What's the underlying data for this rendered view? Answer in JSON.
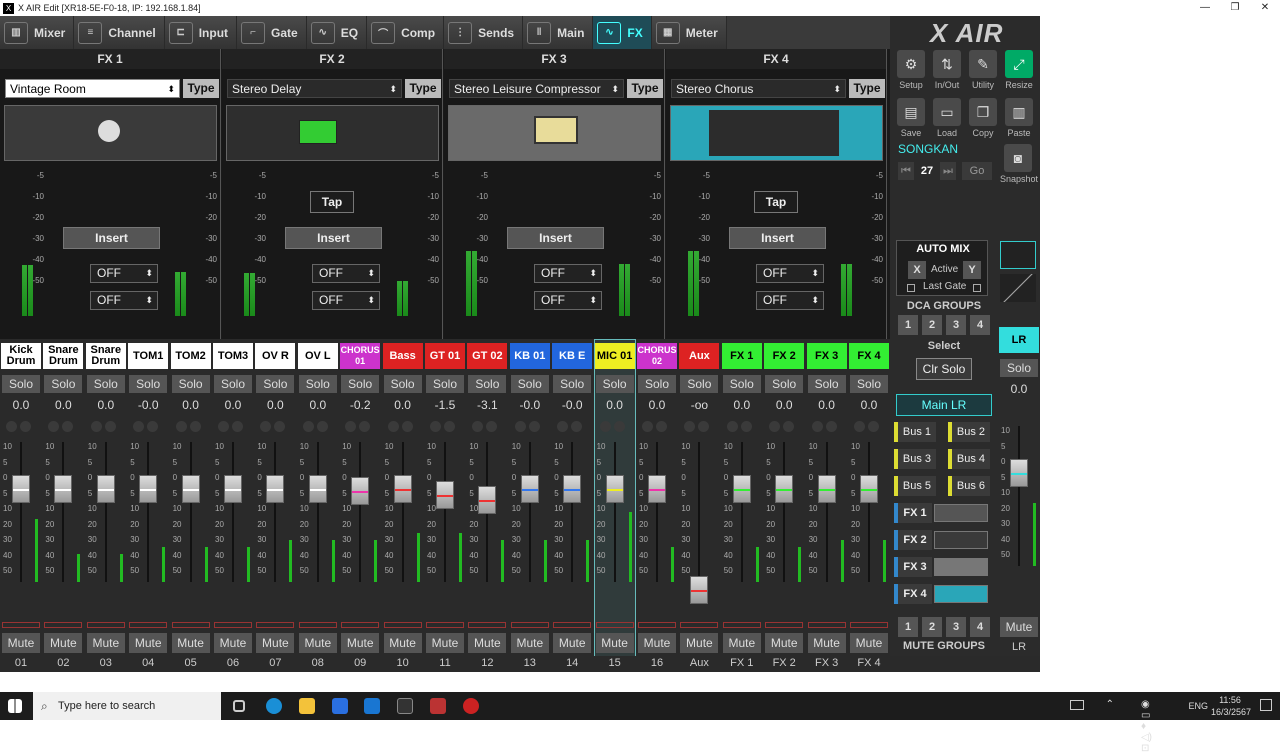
{
  "window": {
    "title": "X AIR Edit [XR18-5E-F0-18, IP: 192.168.1.84]",
    "app_icon": "X",
    "controls": [
      "—",
      "❐",
      "✕"
    ]
  },
  "tabs": [
    {
      "label": "Mixer",
      "icon": "mixer-icon",
      "glyph": "▥"
    },
    {
      "label": "Channel",
      "icon": "channel-icon",
      "glyph": "≡"
    },
    {
      "label": "Input",
      "icon": "input-icon",
      "glyph": "⊏"
    },
    {
      "label": "Gate",
      "icon": "gate-icon",
      "glyph": "⌐"
    },
    {
      "label": "EQ",
      "icon": "eq-icon",
      "glyph": "∿"
    },
    {
      "label": "Comp",
      "icon": "comp-icon",
      "glyph": "⌒"
    },
    {
      "label": "Sends",
      "icon": "sends-icon",
      "glyph": "⋮"
    },
    {
      "label": "Main",
      "icon": "main-icon",
      "glyph": "‖"
    },
    {
      "label": "FX",
      "icon": "fx-icon",
      "glyph": "∿",
      "active": true
    },
    {
      "label": "Meter",
      "icon": "meter-icon",
      "glyph": "▦"
    }
  ],
  "fx_units": [
    {
      "header": "FX 1",
      "preset": "Vintage Room",
      "type_label": "Type",
      "insert_label": "Insert",
      "off1": "OFF",
      "off2": "OFF",
      "theme": "light"
    },
    {
      "header": "FX 2",
      "preset": "Stereo Delay",
      "type_label": "Type",
      "insert_label": "Insert",
      "tap_label": "Tap",
      "off1": "OFF",
      "off2": "OFF",
      "theme": "dark"
    },
    {
      "header": "FX 3",
      "preset": "Stereo Leisure Compressor",
      "type_label": "Type",
      "insert_label": "Insert",
      "off1": "OFF",
      "off2": "OFF",
      "theme": "dark"
    },
    {
      "header": "FX 4",
      "preset": "Stereo Chorus",
      "type_label": "Type",
      "insert_label": "Insert",
      "tap_label": "Tap",
      "off1": "OFF",
      "off2": "OFF",
      "theme": "dark"
    }
  ],
  "fx_meter_scale": [
    "-5",
    "-10",
    "-20",
    "-30",
    "-40",
    "-50"
  ],
  "fader_scale": [
    "10",
    "5",
    "0",
    "5",
    "10",
    "20",
    "30",
    "40",
    "50"
  ],
  "channels": [
    {
      "name": "Kick Drum",
      "color": "#ffffff",
      "solo": "Solo",
      "gain": "0.0",
      "mute": "Mute",
      "num": "01",
      "fader": 0.72,
      "level": 0.45,
      "stripe": "#fff"
    },
    {
      "name": "Snare Drum",
      "color": "#ffffff",
      "solo": "Solo",
      "gain": "0.0",
      "mute": "Mute",
      "num": "02",
      "fader": 0.72,
      "level": 0.2,
      "stripe": "#fff"
    },
    {
      "name": "Snare Drum",
      "color": "#ffffff",
      "solo": "Solo",
      "gain": "0.0",
      "mute": "Mute",
      "num": "03",
      "fader": 0.72,
      "level": 0.2,
      "stripe": "#fff"
    },
    {
      "name": "TOM1",
      "color": "#ffffff",
      "solo": "Solo",
      "gain": "-0.0",
      "mute": "Mute",
      "num": "04",
      "fader": 0.72,
      "level": 0.25,
      "stripe": "#fff"
    },
    {
      "name": "TOM2",
      "color": "#ffffff",
      "solo": "Solo",
      "gain": "0.0",
      "mute": "Mute",
      "num": "05",
      "fader": 0.72,
      "level": 0.25,
      "stripe": "#fff"
    },
    {
      "name": "TOM3",
      "color": "#ffffff",
      "solo": "Solo",
      "gain": "0.0",
      "mute": "Mute",
      "num": "06",
      "fader": 0.72,
      "level": 0.25,
      "stripe": "#fff"
    },
    {
      "name": "OV R",
      "color": "#ffffff",
      "solo": "Solo",
      "gain": "0.0",
      "mute": "Mute",
      "num": "07",
      "fader": 0.72,
      "level": 0.3,
      "stripe": "#fff"
    },
    {
      "name": "OV L",
      "color": "#ffffff",
      "solo": "Solo",
      "gain": "0.0",
      "mute": "Mute",
      "num": "08",
      "fader": 0.72,
      "level": 0.3,
      "stripe": "#fff"
    },
    {
      "name": "CHORUS 01",
      "color": "#cc33cc",
      "solo": "Solo",
      "gain": "-0.2",
      "mute": "Mute",
      "num": "09",
      "fader": 0.71,
      "level": 0.3,
      "stripe": "#e3a"
    },
    {
      "name": "Bass",
      "color": "#dd2222",
      "solo": "Solo",
      "gain": "0.0",
      "mute": "Mute",
      "num": "10",
      "fader": 0.72,
      "level": 0.35,
      "stripe": "#e33"
    },
    {
      "name": "GT 01",
      "color": "#dd2222",
      "solo": "Solo",
      "gain": "-1.5",
      "mute": "Mute",
      "num": "11",
      "fader": 0.68,
      "level": 0.35,
      "stripe": "#e33"
    },
    {
      "name": "GT 02",
      "color": "#dd2222",
      "solo": "Solo",
      "gain": "-3.1",
      "mute": "Mute",
      "num": "12",
      "fader": 0.64,
      "level": 0.3,
      "stripe": "#e33"
    },
    {
      "name": "KB 01",
      "color": "#2266dd",
      "solo": "Solo",
      "gain": "-0.0",
      "mute": "Mute",
      "num": "13",
      "fader": 0.72,
      "level": 0.3,
      "stripe": "#37e"
    },
    {
      "name": "KB E",
      "color": "#2266dd",
      "solo": "Solo",
      "gain": "-0.0",
      "mute": "Mute",
      "num": "14",
      "fader": 0.72,
      "level": 0.3,
      "stripe": "#37e"
    },
    {
      "name": "MIC 01",
      "color": "#eeee22",
      "solo": "Solo",
      "gain": "0.0",
      "mute": "Mute",
      "num": "15",
      "fader": 0.72,
      "level": 0.5,
      "stripe": "#ee2",
      "selected": true
    },
    {
      "name": "CHORUS 02",
      "color": "#cc33cc",
      "solo": "Solo",
      "gain": "0.0",
      "mute": "Mute",
      "num": "16",
      "fader": 0.72,
      "level": 0.25,
      "stripe": "#e3a"
    },
    {
      "name": "Aux",
      "color": "#dd2222",
      "solo": "Solo",
      "gain": "-oo",
      "mute": "Mute",
      "num": "Aux",
      "fader": 0.0,
      "level": 0.0,
      "stripe": "#e33"
    },
    {
      "name": "FX 1",
      "color": "#33ee33",
      "solo": "Solo",
      "gain": "0.0",
      "mute": "Mute",
      "num": "FX 1",
      "fader": 0.72,
      "level": 0.25,
      "stripe": "#3e3"
    },
    {
      "name": "FX 2",
      "color": "#33ee33",
      "solo": "Solo",
      "gain": "0.0",
      "mute": "Mute",
      "num": "FX 2",
      "fader": 0.72,
      "level": 0.25,
      "stripe": "#3e3"
    },
    {
      "name": "FX 3",
      "color": "#33ee33",
      "solo": "Solo",
      "gain": "0.0",
      "mute": "Mute",
      "num": "FX 3",
      "fader": 0.72,
      "level": 0.3,
      "stripe": "#3e3"
    },
    {
      "name": "FX 4",
      "color": "#33ee33",
      "solo": "Solo",
      "gain": "0.0",
      "mute": "Mute",
      "num": "FX 4",
      "fader": 0.72,
      "level": 0.3,
      "stripe": "#3e3"
    }
  ],
  "lr": {
    "name": "LR",
    "color": "#33dddd",
    "solo": "Solo",
    "gain": "0.0",
    "mute": "Mute",
    "num": "LR",
    "level": 0.45
  },
  "right_panel": {
    "logo": "X AIR",
    "top_buttons": [
      {
        "label": "Setup",
        "glyph": "⚙",
        "icon": "setup-icon"
      },
      {
        "label": "In/Out",
        "glyph": "⇅",
        "icon": "in-out-icon"
      },
      {
        "label": "Utility",
        "glyph": "✎",
        "icon": "utility-icon"
      },
      {
        "label": "Resize",
        "glyph": "⤢",
        "icon": "resize-icon",
        "active": true
      }
    ],
    "file_buttons": [
      {
        "label": "Save",
        "glyph": "▤",
        "icon": "save-icon"
      },
      {
        "label": "Load",
        "glyph": "▭",
        "icon": "load-icon"
      },
      {
        "label": "Copy",
        "glyph": "❐",
        "icon": "copy-icon"
      },
      {
        "label": "Paste",
        "glyph": "▥",
        "icon": "paste-icon"
      }
    ],
    "song": "SONGKAN",
    "snap_number": "27",
    "go_label": "Go",
    "snapshot_label": "Snapshot",
    "automix": {
      "title": "AUTO MIX",
      "x": "X",
      "active": "Active",
      "y": "Y",
      "last_gate": "Last Gate"
    },
    "dca_title": "DCA GROUPS",
    "dca": [
      "1",
      "2",
      "3",
      "4"
    ],
    "select_label": "Select",
    "clr_solo": "Clr Solo",
    "main_lr": "Main LR",
    "buses": [
      "Bus 1",
      "Bus 2",
      "Bus 3",
      "Bus 4",
      "Bus 5",
      "Bus 6"
    ],
    "fx_sends": [
      "FX 1",
      "FX 2",
      "FX 3",
      "FX 4"
    ],
    "mute_groups": [
      "1",
      "2",
      "3",
      "4"
    ],
    "mute_groups_title": "MUTE GROUPS"
  },
  "taskbar": {
    "search_placeholder": "Type here to search",
    "lang": "ENG",
    "time": "11:56",
    "date": "16/3/2567"
  },
  "colors": {
    "accent": "#44ffff",
    "bg": "#2b2b2b",
    "meter": "#22bb22"
  }
}
